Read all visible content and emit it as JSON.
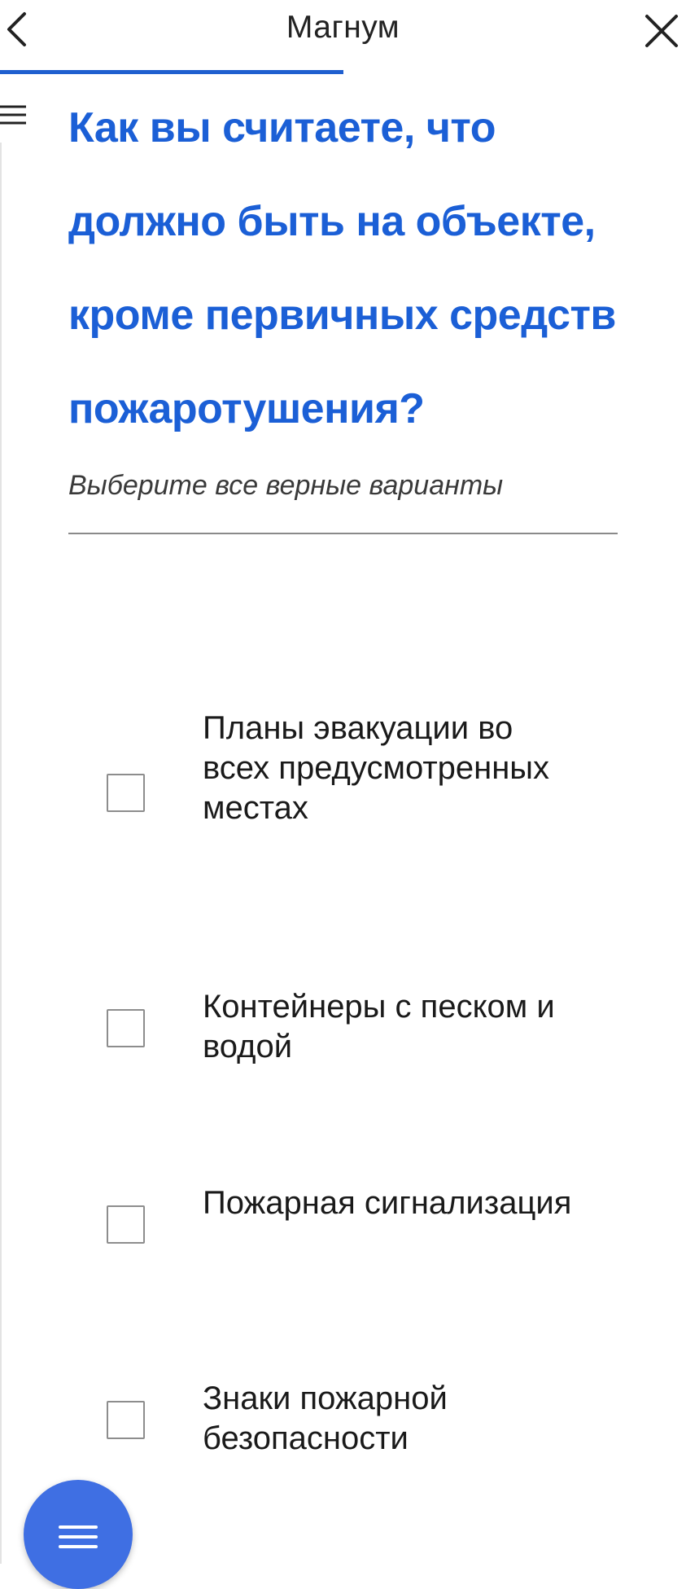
{
  "header": {
    "title": "Магнум",
    "back_icon": "chevron-left-icon",
    "close_icon": "close-icon",
    "progress": 0.5,
    "accent_color": "#1f5fcf"
  },
  "question": {
    "text": "Как вы считаете, что должно быть на объекте, кроме первичных средств пожаротушения?",
    "hint": "Выберите все верные варианты",
    "color": "#1b5fd6"
  },
  "options": [
    {
      "label": "Планы эвакуации во всех предусмотренных местах",
      "checked": false
    },
    {
      "label": "Контейнеры с песком и водой",
      "checked": false
    },
    {
      "label": "Пожарная сигнализация",
      "checked": false
    },
    {
      "label": "Знаки пожарной безопасности",
      "checked": false
    }
  ],
  "fab": {
    "icon": "menu-icon",
    "color": "#3f6fe3"
  },
  "side_menu_icon": "hamburger-icon"
}
